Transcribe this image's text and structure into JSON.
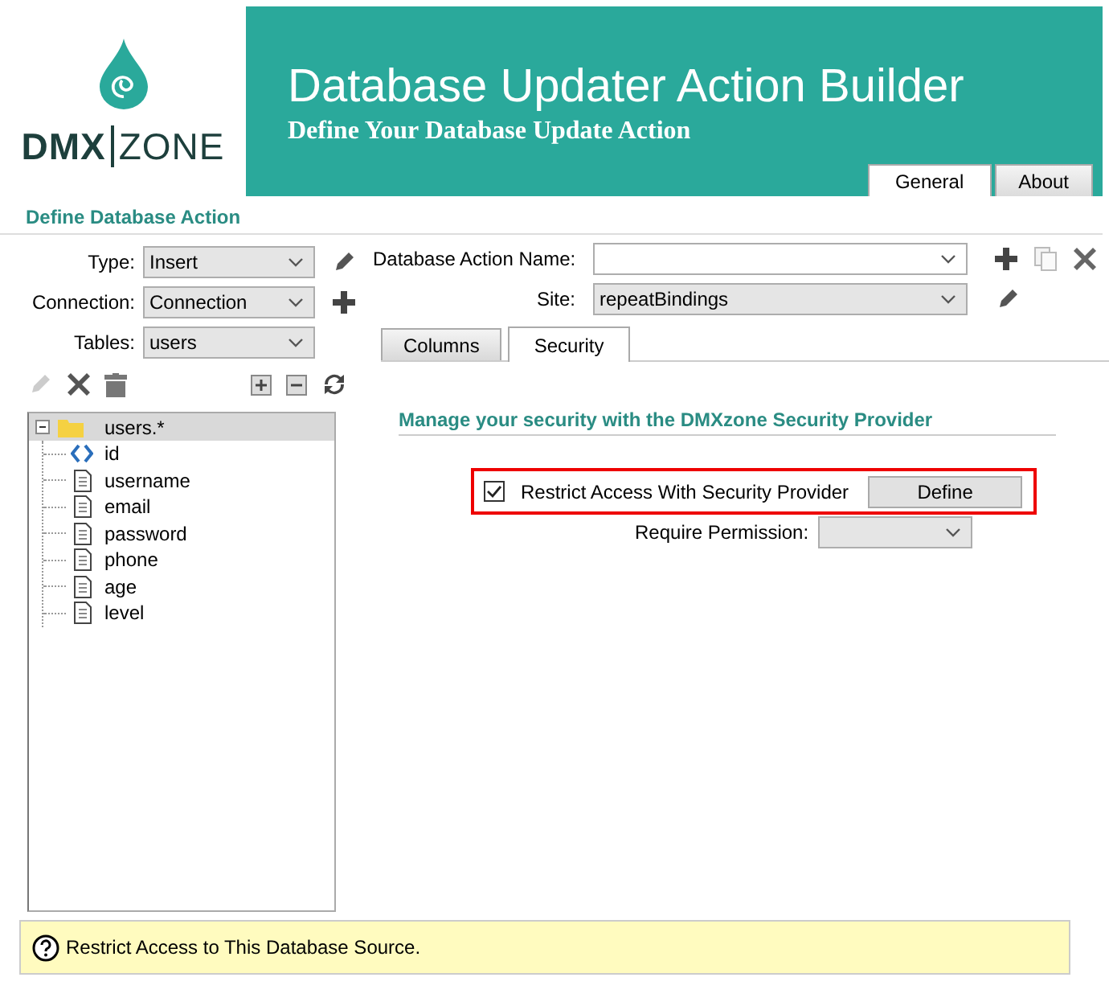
{
  "logo": {
    "brand": "DMX",
    "suffix": "ZONE"
  },
  "header": {
    "title": "Database Updater Action Builder",
    "subtitle": "Define Your Database Update Action"
  },
  "header_tabs": [
    {
      "label": "General",
      "selected": true
    },
    {
      "label": "About",
      "selected": false
    }
  ],
  "section_title": "Define Database Action",
  "fields": [
    {
      "label": "Type:",
      "value": "Insert"
    },
    {
      "label": "Connection:",
      "value": "Connection"
    },
    {
      "label": "Tables:",
      "value": "users"
    }
  ],
  "tree": {
    "label": "users.*",
    "expanded": true,
    "selected": true,
    "children": [
      {
        "label": "id",
        "kind": "key"
      },
      {
        "label": "username",
        "kind": "field"
      },
      {
        "label": "email",
        "kind": "field"
      },
      {
        "label": "password",
        "kind": "field"
      },
      {
        "label": "phone",
        "kind": "field"
      },
      {
        "label": "age",
        "kind": "field"
      },
      {
        "label": "level",
        "kind": "field"
      }
    ]
  },
  "action_name": {
    "label": "Database Action Name:"
  },
  "site": {
    "label": "Site:",
    "value": "repeatBindings"
  },
  "panel_tabs": [
    {
      "label": "Columns",
      "selected": false
    },
    {
      "label": "Security",
      "selected": true
    }
  ],
  "security": {
    "heading": "Manage your security with the DMXzone Security Provider",
    "restrict": {
      "label": "Restrict Access With Security Provider",
      "checked": true
    },
    "define_button": "Define",
    "permission": {
      "label": "Require Permission:"
    }
  },
  "help": "Restrict Access to This Database Source."
}
